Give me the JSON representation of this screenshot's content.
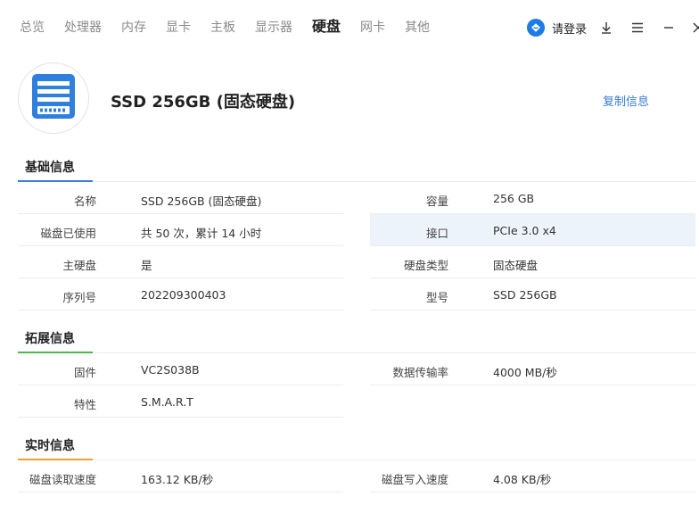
{
  "nav": {
    "tabs": [
      {
        "label": "总览"
      },
      {
        "label": "处理器"
      },
      {
        "label": "内存"
      },
      {
        "label": "显卡"
      },
      {
        "label": "主板"
      },
      {
        "label": "显示器"
      },
      {
        "label": "硬盘",
        "active": true
      },
      {
        "label": "网卡"
      },
      {
        "label": "其他"
      }
    ],
    "login_label": "请登录",
    "icons": {
      "login": "login-avatar-icon",
      "download": "download-icon",
      "menu": "menu-icon",
      "minimize": "minimize-icon",
      "close": "close-icon"
    }
  },
  "device": {
    "title": "SSD 256GB (固态硬盘)",
    "icon": "disk-icon",
    "copy_label": "复制信息"
  },
  "sections": {
    "basic": {
      "title": "基础信息",
      "accent": "#3a7bd5",
      "rows": [
        {
          "left": {
            "label": "名称",
            "value": "SSD 256GB (固态硬盘)"
          },
          "right": {
            "label": "容量",
            "value": "256 GB"
          }
        },
        {
          "left": {
            "label": "磁盘已使用",
            "value": "共 50 次，累计 14 小时"
          },
          "right": {
            "label": "接口",
            "value": "PCIe 3.0 x4"
          }
        },
        {
          "left": {
            "label": "主硬盘",
            "value": "是"
          },
          "right": {
            "label": "硬盘类型",
            "value": "固态硬盘"
          }
        },
        {
          "left": {
            "label": "序列号",
            "value": "202209300403"
          },
          "right": {
            "label": "型号",
            "value": "SSD 256GB"
          }
        }
      ]
    },
    "extended": {
      "title": "拓展信息",
      "accent": "#4cb84c",
      "rows": [
        {
          "left": {
            "label": "固件",
            "value": "VC2S038B"
          },
          "right": {
            "label": "数据传输率",
            "value": "4000 MB/秒"
          }
        },
        {
          "left": {
            "label": "特性",
            "value": "S.M.A.R.T"
          }
        }
      ]
    },
    "realtime": {
      "title": "实时信息",
      "accent": "#f0a030",
      "rows": [
        {
          "left": {
            "label": "磁盘读取速度",
            "value": "163.12 KB/秒"
          },
          "right": {
            "label": "磁盘写入速度",
            "value": "4.08 KB/秒"
          }
        }
      ]
    }
  }
}
